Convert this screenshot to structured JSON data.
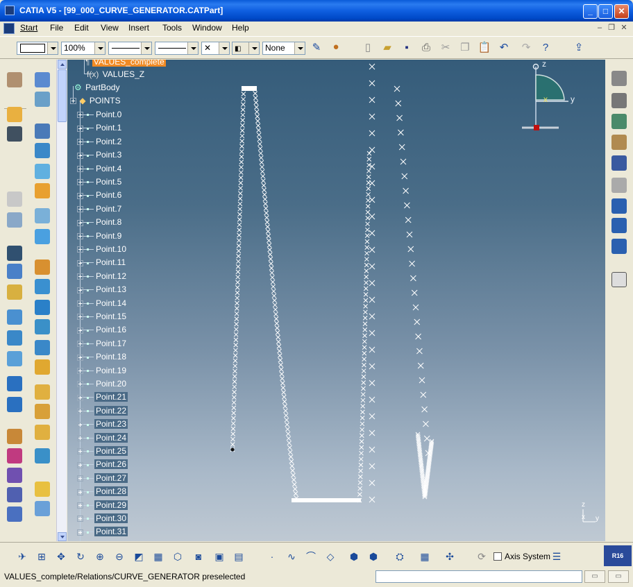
{
  "window": {
    "title": "CATIA V5 - [99_000_CURVE_GENERATOR.CATPart]",
    "minimize": "_",
    "maximize": "□",
    "close": "✕"
  },
  "menu": {
    "items": [
      "Start",
      "File",
      "Edit",
      "View",
      "Insert",
      "Tools",
      "Window",
      "Help"
    ]
  },
  "toolbar": {
    "zoom_value": "100%",
    "linetype_value": "None"
  },
  "tree": {
    "top_item": "VALUES_complete",
    "values_z": "VALUES_Z",
    "partbody": "PartBody",
    "points": "POINTS",
    "point_items": [
      "Point.0",
      "Point.1",
      "Point.2",
      "Point.3",
      "Point.4",
      "Point.5",
      "Point.6",
      "Point.7",
      "Point.8",
      "Point.9",
      "Point.10",
      "Point.11",
      "Point.12",
      "Point.13",
      "Point.14",
      "Point.15",
      "Point.16",
      "Point.17",
      "Point.18",
      "Point.19",
      "Point.20",
      "Point.21",
      "Point.22",
      "Point.23",
      "Point.24",
      "Point.25",
      "Point.26",
      "Point.27",
      "Point.28",
      "Point.29",
      "Point.30",
      "Point.31"
    ]
  },
  "compass": {
    "z": "z",
    "x": "x",
    "y": "y"
  },
  "mini_axis": {
    "z": "z",
    "x": "x",
    "y": "y"
  },
  "bottom_toolbar": {
    "axis_system_label": "Axis System"
  },
  "status": {
    "message": "VALUES_complete/Relations/CURVE_GENERATOR preselected",
    "command_value": ""
  },
  "colors": {
    "viewport_top": "#355c7a",
    "viewport_bottom": "#bfc9d3",
    "highlight": "#f08a24",
    "titlebar": "#0a5bd8"
  }
}
